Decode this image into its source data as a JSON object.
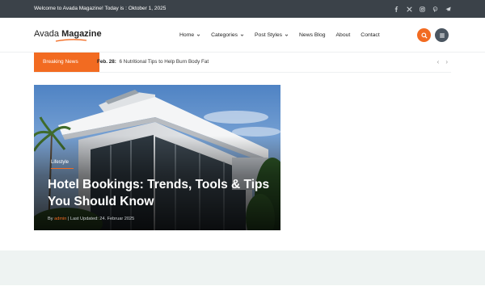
{
  "topbar": {
    "welcome_text": "Welcome to Avada Magazine! Today is : Oktober 1, 2025",
    "social_icons": [
      "facebook-icon",
      "x-icon",
      "instagram-icon",
      "pinterest-icon",
      "telegram-icon"
    ]
  },
  "header": {
    "logo_light": "Avada",
    "logo_bold": "Magazine",
    "nav": [
      {
        "label": "Home",
        "has_dropdown": true
      },
      {
        "label": "Categories",
        "has_dropdown": true
      },
      {
        "label": "Post Styles",
        "has_dropdown": true
      },
      {
        "label": "News Blog",
        "has_dropdown": false
      },
      {
        "label": "About",
        "has_dropdown": false
      },
      {
        "label": "Contact",
        "has_dropdown": false
      }
    ],
    "search_icon": "search-icon",
    "menu_icon": "hamburger-icon"
  },
  "breaking": {
    "label": "Breaking News",
    "date": "Feb. 28:",
    "headline": "6 Nutritional Tips to Help Burn Body Fat",
    "prev": "‹",
    "next": "›"
  },
  "featured": {
    "category": "Lifestyle",
    "title": "Hotel Bookings: Trends, Tools & Tips You Should Know",
    "meta_prefix": "By",
    "author": "admin",
    "meta_suffix": "| Last Updated: 24. Februar 2025"
  },
  "colors": {
    "accent": "#f26b21",
    "topbar_bg": "#3b4249",
    "menu_button_bg": "#4a5560",
    "band_bg": "#eef3f2"
  }
}
